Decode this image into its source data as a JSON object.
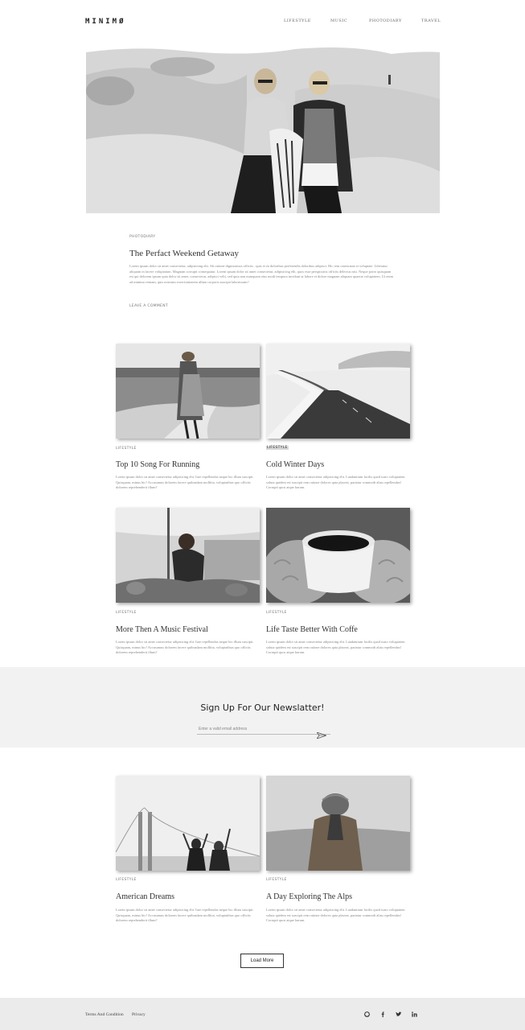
{
  "header": {
    "logo": "MINIMØ",
    "nav": [
      "LIFESTYLE",
      "MUSIC",
      "PHOTODIARY",
      "TRAVEL"
    ]
  },
  "featured": {
    "category": "PHOTODIARY",
    "title": "The Perfact Weekend Getaway",
    "excerpt": "Lorem ipsum dolor sit amet consectetur, adipisicing elit. Ab ratione dignissimos officiis ..quis et ea doloribus perferendis doloribus adipisci. Hic rem oraeoratae et voluptate. Liberatur aliquam in facere voluptatum. Magnam corrupti consequatur. Lorem ipsum dolor sit amet consectetur, adipisicing elit, quos esse perspiciatis officiis delectus nisi. Neque porro quisquam est qui dolorem ipsum quia dolor sit amet, consectetur, adipisci velit, sed quia non numquam eius modi tempora incidunt ut labore et dolore magnam aliquam quaerat voluptatem. Ut enim ad minima veniam, quis nostrum exercitationem ullam corporis suscipit laboriosam?",
    "action": "LEAVE A COMMENT"
  },
  "posts": [
    {
      "category": "LIFESTYLE",
      "title": "Top 10 Song For Running",
      "excerpt": "Lorem ipsum dolor sit amet consectetur adipisicing elit. Iure repellendus neque hic illum suscipit. Quisquam, minus hic! Accusamus dolorem facere quibusdam mollitia, voluptatibus quo officiis dolorem reprehenderit illum?"
    },
    {
      "category": "LIFESTYLE",
      "title": "Cold Winter Days",
      "excerpt": "Lorem ipsum dolor sit amet consectetur adipisicing elit. Laudantium facilis quod iusto voluptatem soluta quidem est suscipit rem ratione dolores quia placeat, pariatur commodi alias repellendus! Corrupti quos atque harum."
    },
    {
      "category": "LIFESTYLE",
      "title": "More Then A Music Festival",
      "excerpt": "Lorem ipsum dolor sit amet consectetur adipisicing elit. Iure repellendus neque hic illum suscipit. Quisquam, minus hic! Accusamus dolorem facere quibusdam mollitia, voluptatibus quo officiis dolorem reprehenderit illum?"
    },
    {
      "category": "LIFESTYLE",
      "title": "Life Taste Better With Coffe",
      "excerpt": "Lorem ipsum dolor sit amet consectetur adipisicing elit. Laudantium facilis quod iusto voluptatem soluta quidem est suscipit rem ratione dolores quia placeat, pariatur commodi alias repellendus! Corrupti quos atque harum."
    },
    {
      "category": "LIFESTYLE",
      "title": "American Dreams",
      "excerpt": "Lorem ipsum dolor sit amet consectetur adipisicing elit. Iure repellendus neque hic illum suscipit. Quisquam, minus hic! Accusamus dolorem facere quibusdam mollitia, voluptatibus quo officiis dolorem reprehenderit illum?"
    },
    {
      "category": "LIFESTYLE",
      "title": "A Day Exploring The Alps",
      "excerpt": "Lorem ipsum dolor sit amet consectetur adipisicing elit. Laudantium facilis quod iusto voluptatem soluta quidem est suscipit rem ratione dolores quia placeat, pariatur commodi alias repellendus! Corrupti quos atque harum."
    }
  ],
  "newsletter": {
    "title": "Sign Up For Our Newslatter!",
    "placeholder": "Enter a valid email address",
    "send_icon": "paper-plane-icon"
  },
  "load_more": "Load More",
  "footer": {
    "links": [
      "Terms And Condition",
      "Privacy"
    ],
    "social_icons": [
      "github-icon",
      "facebook-icon",
      "twitter-icon",
      "linkedin-icon"
    ]
  }
}
